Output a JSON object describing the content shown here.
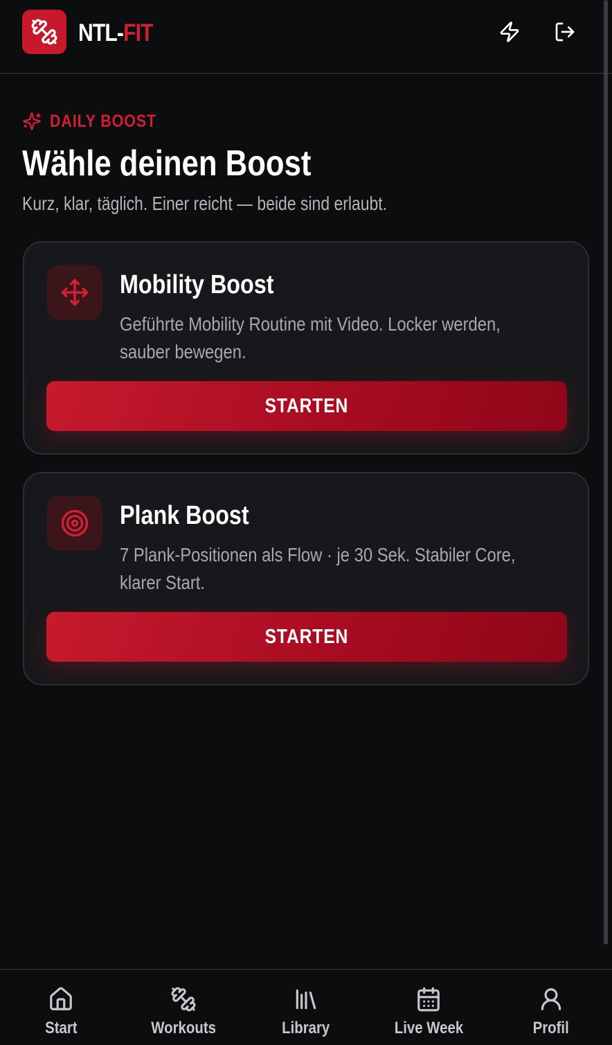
{
  "app": {
    "brand_part1": "NTL-",
    "brand_part2": "FIT",
    "accent_color": "#c8182b",
    "logo_icon": "dumbbell-icon"
  },
  "header": {
    "actions": [
      {
        "icon": "lightning-icon"
      },
      {
        "icon": "logout-icon"
      }
    ]
  },
  "main": {
    "eyebrow": "DAILY BOOST",
    "title": "Wähle deinen Boost",
    "subtitle": "Kurz, klar, täglich. Einer reicht — beide sind erlaubt.",
    "cards": [
      {
        "icon": "move-arrows-icon",
        "title": "Mobility Boost",
        "description": "Geführte Mobility Routine mit Video. Locker werden, sauber bewegen.",
        "button": "STARTEN"
      },
      {
        "icon": "target-icon",
        "title": "Plank Boost",
        "description": "7 Plank-Positionen als Flow · je 30 Sek. Stabiler Core, klarer Start.",
        "button": "STARTEN"
      }
    ]
  },
  "bottom_nav": {
    "items": [
      {
        "label": "Start",
        "icon": "home-icon"
      },
      {
        "label": "Workouts",
        "icon": "dumbbell-icon"
      },
      {
        "label": "Library",
        "icon": "library-icon"
      },
      {
        "label": "Live Week",
        "icon": "calendar-icon"
      },
      {
        "label": "Profil",
        "icon": "user-icon"
      }
    ]
  }
}
